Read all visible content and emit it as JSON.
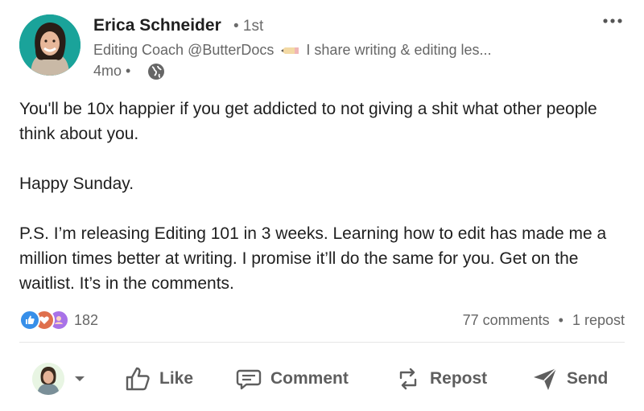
{
  "author": {
    "name": "Erica Schneider",
    "degree": "• 1st",
    "headline_pre": "Editing Coach @ButterDocs",
    "headline_post": "I share writing & editing les...",
    "timestamp": "4mo •",
    "avatar_icon": "person-photo",
    "headline_icon": "pencil-emoji",
    "visibility_icon": "globe-icon"
  },
  "post": {
    "line1": "You'll be 10x happier if you get addicted to not giving a shit what other people think about you.",
    "line2": "Happy Sunday.",
    "line3": "P.S. I’m releasing Editing 101 in 3 weeks. Learning how to edit has made me a million times better at writing. I promise it’ll do the same for you. Get on the waitlist. It’s in the comments."
  },
  "social": {
    "reaction_count": "182",
    "reaction_icons": [
      "like-icon",
      "love-icon",
      "support-icon"
    ],
    "comments": "77 comments",
    "separator": "•",
    "reposts": "1 repost"
  },
  "actions": {
    "like": "Like",
    "comment": "Comment",
    "repost": "Repost",
    "send": "Send"
  },
  "colors": {
    "text": "#1f1f1f",
    "muted": "#666666",
    "action": "#5e5e5e",
    "like_blue": "#378fe9",
    "love_red": "#df704d",
    "support_purple": "#a872e8",
    "avatar_bg": "#1aa39a"
  }
}
